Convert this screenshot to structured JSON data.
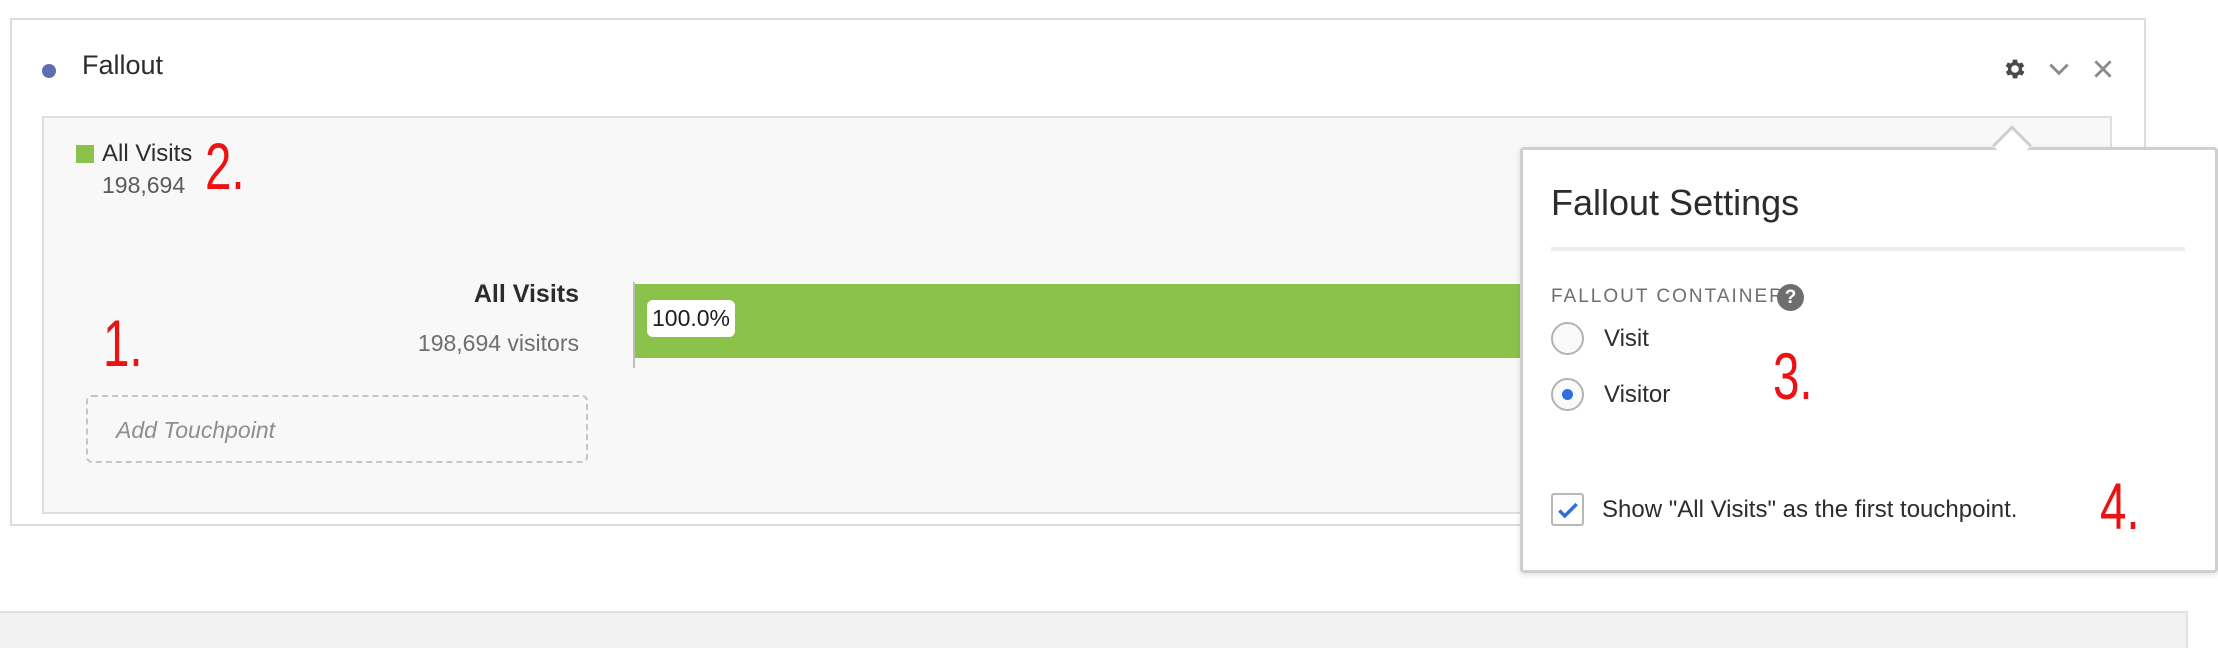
{
  "panel": {
    "title": "Fallout",
    "accent_color": "#5b6eb0",
    "icons": [
      "gear-icon",
      "chevron-down-icon",
      "close-icon"
    ]
  },
  "legend": {
    "label": "All Visits",
    "count": "198,694",
    "color": "#8bc34a"
  },
  "touchpoints": [
    {
      "name": "All Visits",
      "visitors": "198,694 visitors",
      "percent_label": "100.0%",
      "percent": 100
    }
  ],
  "add_touchpoint_placeholder": "Add Touchpoint",
  "settings": {
    "title": "Fallout Settings",
    "section_label": "FALLOUT CONTAINER",
    "help_glyph": "?",
    "options": [
      {
        "label": "Visit",
        "selected": false
      },
      {
        "label": "Visitor",
        "selected": true
      }
    ],
    "checkbox_label": "Show \"All Visits\" as the first touchpoint.",
    "checkbox_checked": true
  },
  "annotations": [
    "1.",
    "2.",
    "3.",
    "4."
  ]
}
